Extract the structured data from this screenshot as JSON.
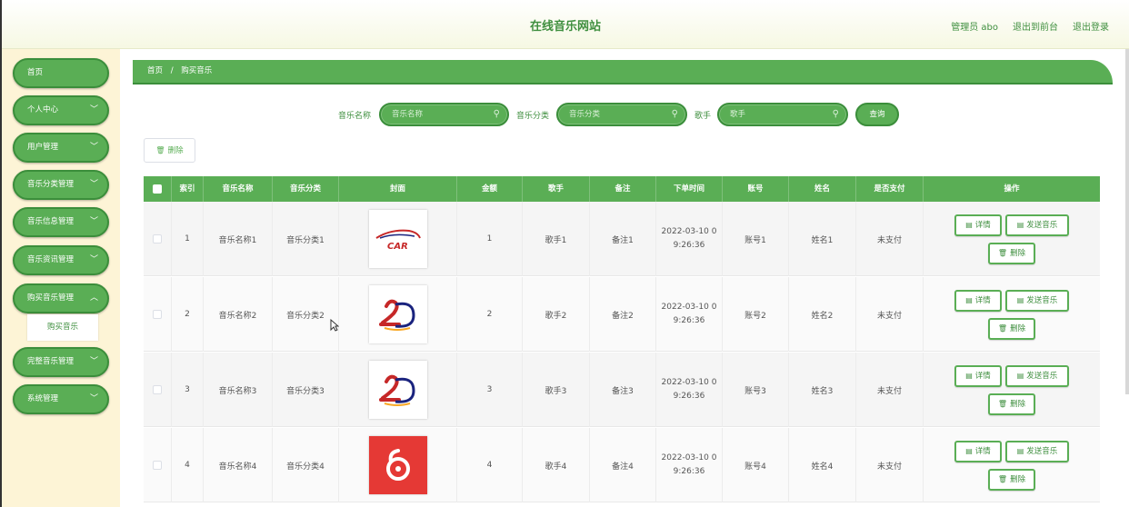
{
  "header": {
    "title": "在线音乐网站",
    "admin": "管理员 abo",
    "back_to_front": "退出到前台",
    "logout": "退出登录"
  },
  "sidebar": {
    "items": [
      {
        "label": "首页",
        "chevron": false
      },
      {
        "label": "个人中心",
        "chevron": true
      },
      {
        "label": "用户管理",
        "chevron": true
      },
      {
        "label": "音乐分类管理",
        "chevron": true
      },
      {
        "label": "音乐信息管理",
        "chevron": true
      },
      {
        "label": "音乐资讯管理",
        "chevron": true
      },
      {
        "label": "购买音乐管理",
        "chevron": true
      },
      {
        "label": "完整音乐管理",
        "chevron": true
      },
      {
        "label": "系统管理",
        "chevron": true
      }
    ],
    "sub_item": "购买音乐"
  },
  "breadcrumb": {
    "home": "首页",
    "sep": "/",
    "current": "购买音乐"
  },
  "search": {
    "name_label": "音乐名称",
    "name_placeholder": "音乐名称",
    "category_label": "音乐分类",
    "category_placeholder": "音乐分类",
    "singer_label": "歌手",
    "singer_placeholder": "歌手",
    "query_button": "查询"
  },
  "toolbar": {
    "delete_label": "删除"
  },
  "table": {
    "columns": [
      "",
      "索引",
      "音乐名称",
      "音乐分类",
      "封面",
      "金额",
      "歌手",
      "备注",
      "下单时间",
      "账号",
      "姓名",
      "是否支付",
      "操作"
    ],
    "rows": [
      {
        "index": "1",
        "name": "音乐名称1",
        "category": "音乐分类1",
        "cover": "car-logo",
        "amount": "1",
        "singer": "歌手1",
        "note": "备注1",
        "time_line1": "2022-03-10 0",
        "time_line2": "9:26:36",
        "account": "账号1",
        "realname": "姓名1",
        "paid": "未支付"
      },
      {
        "index": "2",
        "name": "音乐名称2",
        "category": "音乐分类2",
        "cover": "2d-logo",
        "amount": "2",
        "singer": "歌手2",
        "note": "备注2",
        "time_line1": "2022-03-10 0",
        "time_line2": "9:26:36",
        "account": "账号2",
        "realname": "姓名2",
        "paid": "未支付"
      },
      {
        "index": "3",
        "name": "音乐名称3",
        "category": "音乐分类3",
        "cover": "2d-logo",
        "amount": "3",
        "singer": "歌手3",
        "note": "备注3",
        "time_line1": "2022-03-10 0",
        "time_line2": "9:26:36",
        "account": "账号3",
        "realname": "姓名3",
        "paid": "未支付"
      },
      {
        "index": "4",
        "name": "音乐名称4",
        "category": "音乐分类4",
        "cover": "netease-logo",
        "amount": "4",
        "singer": "歌手4",
        "note": "备注4",
        "time_line1": "2022-03-10 0",
        "time_line2": "9:26:36",
        "account": "账号4",
        "realname": "姓名4",
        "paid": "未支付"
      }
    ],
    "actions": {
      "detail": "详情",
      "send": "发送音乐",
      "delete": "删除"
    }
  },
  "colors": {
    "primary": "#5aae55",
    "primary_dark": "#3b8e3b",
    "sidebar_bg": "#fdf4d6"
  }
}
